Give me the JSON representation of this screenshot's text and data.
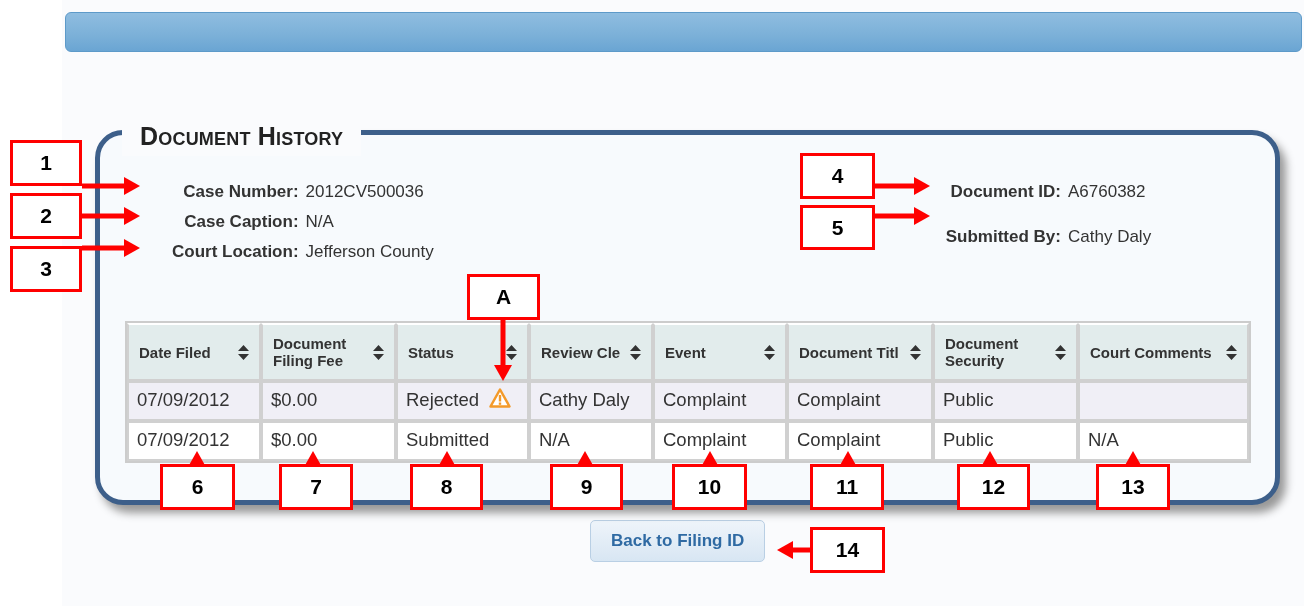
{
  "panel": {
    "title": "Document History"
  },
  "case_info": [
    {
      "label": "Case Number:",
      "value": "2012CV500036"
    },
    {
      "label": "Case Caption:",
      "value": "N/A"
    },
    {
      "label": "Court Location:",
      "value": "Jefferson County"
    }
  ],
  "document_info": [
    {
      "label": "Document ID:",
      "value": "A6760382"
    },
    {
      "label": "Submitted By:",
      "value": "Cathy Daly"
    }
  ],
  "table": {
    "columns": [
      "Date Filed",
      "Document Filing Fee",
      "Status",
      "Review Cle",
      "Event",
      "Document Titl",
      "Document Security",
      "Court Comments"
    ],
    "rows": [
      {
        "cells": [
          "07/09/2012",
          "$0.00",
          "Rejected",
          "Cathy Daly",
          "Complaint",
          "Complaint",
          "Public",
          ""
        ],
        "warning": true
      },
      {
        "cells": [
          "07/09/2012",
          "$0.00",
          "Submitted",
          "N/A",
          "Complaint",
          "Complaint",
          "Public",
          "N/A"
        ],
        "warning": false
      }
    ]
  },
  "back_button": "Back to Filing ID",
  "callouts": [
    {
      "label": "1"
    },
    {
      "label": "2"
    },
    {
      "label": "3"
    },
    {
      "label": "4"
    },
    {
      "label": "5"
    },
    {
      "label": "A"
    },
    {
      "label": "6"
    },
    {
      "label": "7"
    },
    {
      "label": "8"
    },
    {
      "label": "9"
    },
    {
      "label": "10"
    },
    {
      "label": "11"
    },
    {
      "label": "12"
    },
    {
      "label": "13"
    },
    {
      "label": "14"
    }
  ]
}
